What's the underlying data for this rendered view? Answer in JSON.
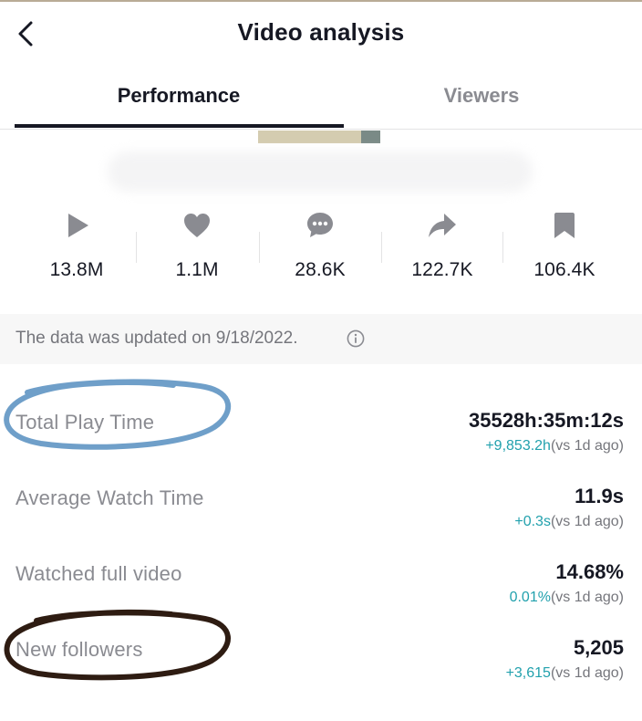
{
  "header": {
    "title": "Video analysis"
  },
  "tabs": [
    {
      "label": "Performance",
      "active": true
    },
    {
      "label": "Viewers",
      "active": false
    }
  ],
  "stats": [
    {
      "icon": "play-icon",
      "value": "13.8M"
    },
    {
      "icon": "heart-icon",
      "value": "1.1M"
    },
    {
      "icon": "comment-icon",
      "value": "28.6K"
    },
    {
      "icon": "share-icon",
      "value": "122.7K"
    },
    {
      "icon": "bookmark-icon",
      "value": "106.4K"
    }
  ],
  "notice": {
    "text": "The data was updated on 9/18/2022."
  },
  "metrics": [
    {
      "label": "Total Play Time",
      "value": "35528h:35m:12s",
      "change": "+9,853.2h",
      "compare": "(vs 1d ago)"
    },
    {
      "label": "Average Watch Time",
      "value": "11.9s",
      "change": "+0.3s",
      "compare": "(vs 1d ago)"
    },
    {
      "label": "Watched full video",
      "value": "14.68%",
      "change": "0.01%",
      "compare": "(vs 1d ago)"
    },
    {
      "label": "New followers",
      "value": "5,205",
      "change": "+3,615",
      "compare": "(vs 1d ago)"
    }
  ],
  "colors": {
    "accent_positive": "#22a1ad",
    "annotation_blue": "#6f9fc9",
    "annotation_brown": "#2e1c12"
  }
}
